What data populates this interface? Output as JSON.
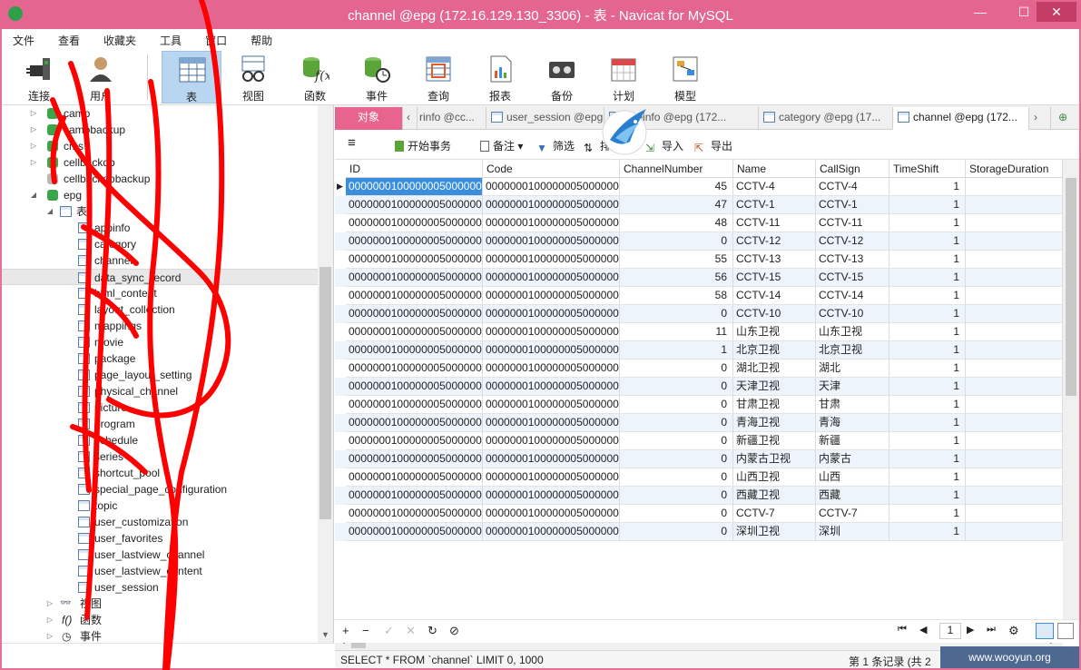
{
  "window": {
    "title": "channel @epg (172.16.129.130_3306) - 表 - Navicat for MySQL",
    "minimize": "—",
    "maximize": "☐",
    "close": "✕"
  },
  "menu": [
    "文件",
    "查看",
    "收藏夹",
    "工具",
    "窗口",
    "帮助"
  ],
  "toolbar": [
    {
      "label": "连接",
      "icon": "plug-icon"
    },
    {
      "label": "用户",
      "icon": "user-icon"
    },
    {
      "label": "表",
      "icon": "table-icon",
      "active": true
    },
    {
      "label": "视图",
      "icon": "view-glasses-icon"
    },
    {
      "label": "函数",
      "icon": "function-icon"
    },
    {
      "label": "事件",
      "icon": "event-clock-icon"
    },
    {
      "label": "查询",
      "icon": "query-icon"
    },
    {
      "label": "报表",
      "icon": "report-icon"
    },
    {
      "label": "备份",
      "icon": "backup-tape-icon"
    },
    {
      "label": "计划",
      "icon": "calendar-icon"
    },
    {
      "label": "模型",
      "icon": "model-icon"
    }
  ],
  "tree": {
    "databases": [
      "camp",
      "campbackup",
      "cms",
      "cellbackdb",
      "cellbackdbbackup"
    ],
    "epg": "epg",
    "tables_folder": "表",
    "tables": [
      "appinfo",
      "category",
      "channel",
      "data_sync_record",
      "html_content",
      "layout_collection",
      "mappings",
      "movie",
      "package",
      "page_layout_setting",
      "physical_channel",
      "picture",
      "program",
      "schedule",
      "series",
      "shortcut_pool",
      "special_page_configuration",
      "topic",
      "user_customization",
      "user_favorites",
      "user_lastview_channel",
      "user_lastview_content",
      "user_session"
    ],
    "others": [
      "视图",
      "函数",
      "事件"
    ]
  },
  "tabs": {
    "objects": "对象",
    "items": [
      "rinfo @cc...",
      "user_session @epg",
      "appinfo @epg (172...",
      "category @epg (17...",
      "channel @epg (172..."
    ]
  },
  "subtoolbar": {
    "begin_tx": "开始事务",
    "note": "备注",
    "filter": "筛选",
    "sort": "排序",
    "import": "导入",
    "export": "导出"
  },
  "grid": {
    "columns": [
      "ID",
      "Code",
      "ChannelNumber",
      "Name",
      "CallSign",
      "TimeShift",
      "StorageDuration"
    ],
    "rows": [
      [
        "00000001000000050000000",
        "00000001000000050000000",
        "45",
        "CCTV-4",
        "CCTV-4",
        "1",
        ""
      ],
      [
        "00000001000000050000000",
        "00000001000000050000000",
        "47",
        "CCTV-1",
        "CCTV-1",
        "1",
        ""
      ],
      [
        "00000001000000050000000",
        "00000001000000050000000",
        "48",
        "CCTV-11",
        "CCTV-11",
        "1",
        ""
      ],
      [
        "00000001000000050000000",
        "00000001000000050000000",
        "0",
        "CCTV-12",
        "CCTV-12",
        "1",
        ""
      ],
      [
        "00000001000000050000000",
        "00000001000000050000000",
        "55",
        "CCTV-13",
        "CCTV-13",
        "1",
        ""
      ],
      [
        "00000001000000050000000",
        "00000001000000050000000",
        "56",
        "CCTV-15",
        "CCTV-15",
        "1",
        ""
      ],
      [
        "00000001000000050000000",
        "00000001000000050000000",
        "58",
        "CCTV-14",
        "CCTV-14",
        "1",
        ""
      ],
      [
        "00000001000000050000000",
        "00000001000000050000000",
        "0",
        "CCTV-10",
        "CCTV-10",
        "1",
        ""
      ],
      [
        "00000001000000050000000",
        "00000001000000050000000",
        "11",
        "山东卫视",
        "山东卫视",
        "1",
        ""
      ],
      [
        "00000001000000050000000",
        "00000001000000050000000",
        "1",
        "北京卫视",
        "北京卫视",
        "1",
        ""
      ],
      [
        "00000001000000050000000",
        "00000001000000050000000",
        "0",
        "湖北卫视",
        "湖北",
        "1",
        ""
      ],
      [
        "00000001000000050000000",
        "00000001000000050000000",
        "0",
        "天津卫视",
        "天津",
        "1",
        ""
      ],
      [
        "00000001000000050000000",
        "00000001000000050000000",
        "0",
        "甘肃卫视",
        "甘肃",
        "1",
        ""
      ],
      [
        "00000001000000050000000",
        "00000001000000050000000",
        "0",
        "青海卫视",
        "青海",
        "1",
        ""
      ],
      [
        "00000001000000050000000",
        "00000001000000050000000",
        "0",
        "新疆卫视",
        "新疆",
        "1",
        ""
      ],
      [
        "00000001000000050000000",
        "00000001000000050000000",
        "0",
        "内蒙古卫视",
        "内蒙古",
        "1",
        ""
      ],
      [
        "00000001000000050000000",
        "00000001000000050000000",
        "0",
        "山西卫视",
        "山西",
        "1",
        ""
      ],
      [
        "00000001000000050000000",
        "00000001000000050000000",
        "0",
        "西藏卫视",
        "西藏",
        "1",
        ""
      ],
      [
        "00000001000000050000000",
        "00000001000000050000000",
        "0",
        "CCTV-7",
        "CCTV-7",
        "1",
        ""
      ],
      [
        "00000001000000050000000",
        "00000001000000050000000",
        "0",
        "深圳卫视",
        "深圳",
        "1",
        ""
      ]
    ]
  },
  "bottombar": {
    "add": "+",
    "remove": "−",
    "apply": "✓",
    "cancel": "✕",
    "refresh": "↻",
    "stop": "⊘",
    "page": "1"
  },
  "status": {
    "sql": "SELECT * FROM `channel` LIMIT 0, 1000",
    "records": "第 1 条记录 (共 2"
  },
  "watermark": "www.wooyun.org",
  "colors": {
    "titlebar": "#e4658f",
    "selection": "#3a8ee0",
    "scribble": "#ff0000"
  }
}
